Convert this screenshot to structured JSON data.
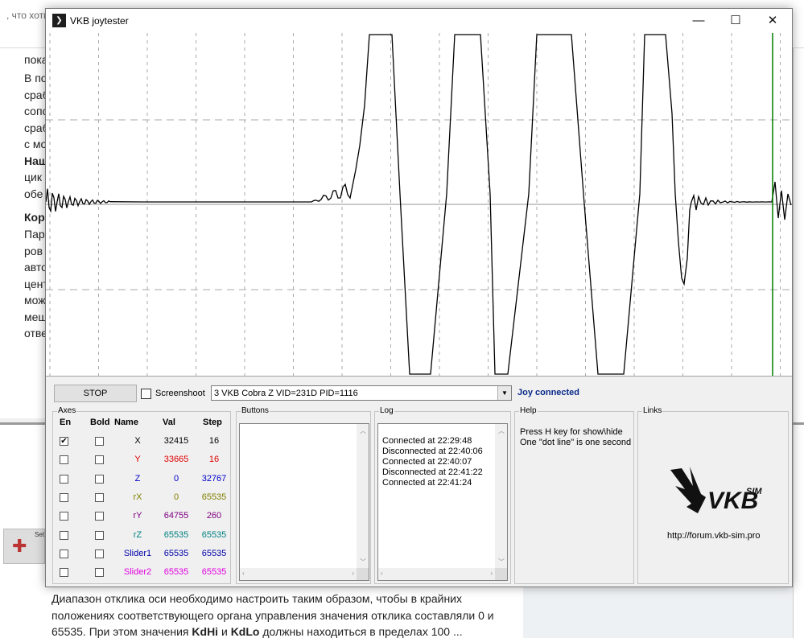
{
  "background": {
    "search_hint": ", что хоти",
    "article_lines": [
      "пока",
      "В по",
      "сраб",
      "сопо",
      "сраб",
      "с мо",
      "Наш",
      "цик",
      "обе",
      "Кор",
      "Пар",
      "ров",
      "авто",
      "цент",
      "мож",
      "меш",
      "отве"
    ],
    "thumb_label": "Set",
    "bottom_text_1": "Диапазон отклика оси необходимо настроить таким образом, чтобы в крайних положениях соответствующего органа управления значения отклика составляли 0 и 65535. При этом значения ",
    "bottom_bold_1": "KdHi",
    "bottom_and": " и ",
    "bottom_bold_2": "KdLo",
    "bottom_text_2": " должны находиться в пределах 100 ..."
  },
  "window": {
    "title": "VKB joytester",
    "icon": "vkb-bird-icon",
    "minimize_glyph": "—",
    "maximize_glyph": "☐",
    "close_glyph": "✕"
  },
  "toolbar": {
    "stop_label": "STOP",
    "screenshot_label": "Screenshoot",
    "screenshot_checked": false,
    "device_selected": "3 VKB Cobra Z VID=231D PID=1116",
    "status": "Joy connected",
    "status_color": "#0a2a8a"
  },
  "axes": {
    "legend": "Axes",
    "headers": {
      "en": "En",
      "bold": "Bold",
      "name": "Name",
      "val": "Val",
      "step": "Step"
    },
    "rows": [
      {
        "enabled": true,
        "bold": false,
        "name": "X",
        "val": "32415",
        "step": "16",
        "color": "#000000"
      },
      {
        "enabled": false,
        "bold": false,
        "name": "Y",
        "val": "33665",
        "step": "16",
        "color": "#e00000"
      },
      {
        "enabled": false,
        "bold": false,
        "name": "Z",
        "val": "0",
        "step": "32767",
        "color": "#0000cc"
      },
      {
        "enabled": false,
        "bold": false,
        "name": "rX",
        "val": "0",
        "step": "65535",
        "color": "#808000"
      },
      {
        "enabled": false,
        "bold": false,
        "name": "rY",
        "val": "64755",
        "step": "260",
        "color": "#800080"
      },
      {
        "enabled": false,
        "bold": false,
        "name": "rZ",
        "val": "65535",
        "step": "65535",
        "color": "#008080"
      },
      {
        "enabled": false,
        "bold": false,
        "name": "Slider1",
        "val": "65535",
        "step": "65535",
        "color": "#0000aa"
      },
      {
        "enabled": false,
        "bold": false,
        "name": "Slider2",
        "val": "65535",
        "step": "65535",
        "color": "#e000e0"
      }
    ]
  },
  "buttons_panel": {
    "legend": "Buttons"
  },
  "log": {
    "legend": "Log",
    "lines": [
      "Connected at 22:29:48",
      "Disconnected at 22:40:06",
      "Connected at 22:40:07",
      "Disconnected at 22:41:22",
      "Connected at 22:41:24"
    ]
  },
  "help": {
    "legend": "Help",
    "lines": [
      "Press H key for show\\hide",
      "One \"dot line\" is one second"
    ]
  },
  "links": {
    "legend": "Links",
    "logo_text": "VKB",
    "logo_sim": "SIM",
    "url": "http://forum.vkb-sim.pro"
  },
  "plot": {
    "trace_color": "#000000",
    "cursor_color": "#008000",
    "grid_color": "#aaaaaa"
  }
}
